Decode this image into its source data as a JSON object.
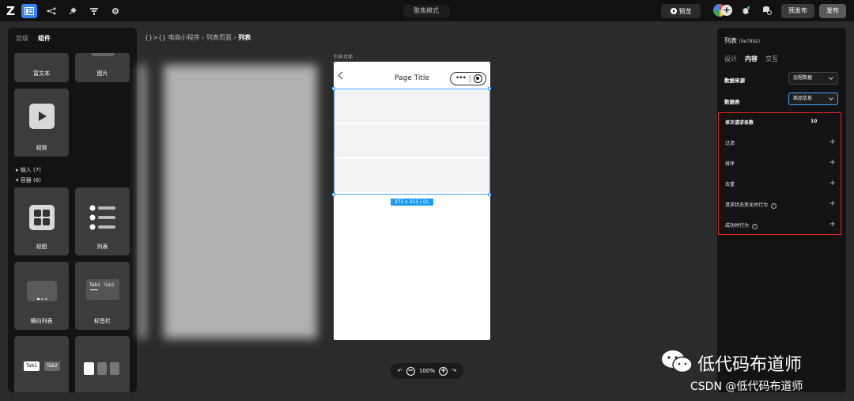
{
  "topbar": {
    "logo": "Z",
    "mode_title": "聚焦模式",
    "preview_label": "预览",
    "prepublish_label": "预发布",
    "publish_label": "发布"
  },
  "left_panel": {
    "tabs": [
      "层级",
      "组件"
    ],
    "cards": [
      {
        "label": "富文本"
      },
      {
        "label": "图片"
      },
      {
        "label": "视频"
      },
      {
        "label": "视图"
      },
      {
        "label": "列表"
      },
      {
        "label": "横向列表"
      },
      {
        "label": "标签栏"
      }
    ],
    "groups": [
      "▸ 输入 (7)",
      "▾ 容器 (6)"
    ],
    "tab_demo": [
      "Tab1",
      "Tab2"
    ],
    "tab_bar_demo": [
      "Tab1",
      "Tab2"
    ]
  },
  "canvas": {
    "breadcrumb_prefix": "{}>{} 电商小程序 › 列表页面 › ",
    "breadcrumb_current": "列表",
    "page_label": "列表页面",
    "page_title": "Page Title",
    "size_tag": "375 x 255 | (0, 65)",
    "zoom": "100%"
  },
  "right_panel": {
    "title": "列表",
    "title_id": "(lie78tsi)",
    "tabs": [
      "设计",
      "内容",
      "交互"
    ],
    "data_source_label": "数据来源",
    "data_source_value": "远程数据",
    "table_label": "数据表",
    "table_value": "商品信息",
    "per_request_label": "单次请求条数",
    "per_request_value": "10",
    "filter_label": "过滤",
    "sort_label": "排序",
    "dedupe_label": "去重",
    "status_change_label": "请求状态变化时行为",
    "success_label": "成功时行为"
  },
  "watermark": {
    "main": "低代码布道师",
    "sub": "CSDN @低代码布道师"
  }
}
